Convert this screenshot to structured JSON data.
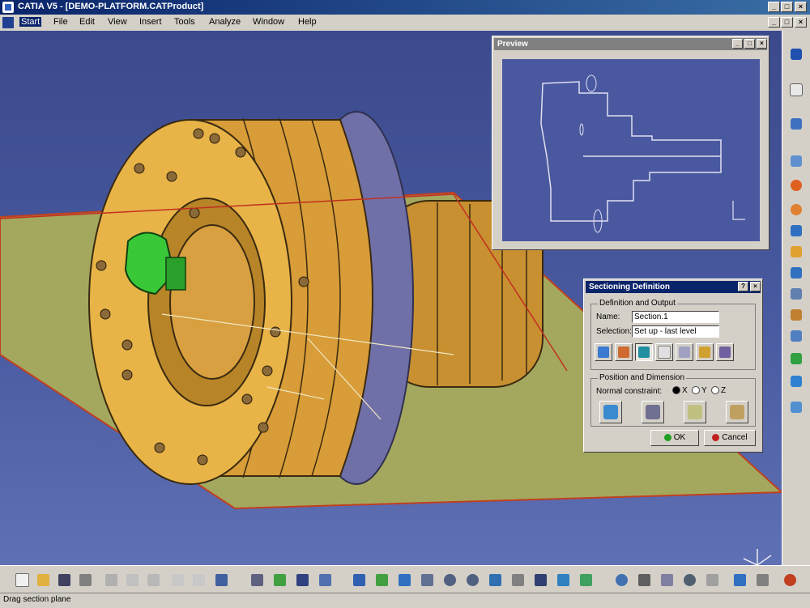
{
  "window": {
    "title": "CATIA V5 - [DEMO-PLATFORM.CATProduct]"
  },
  "menu": [
    "Start",
    "File",
    "Edit",
    "View",
    "Insert",
    "Tools",
    "Analyze",
    "Window",
    "Help"
  ],
  "preview": {
    "title": "Preview"
  },
  "sectioning": {
    "title": "Sectioning Definition",
    "group1": "Definition and Output",
    "name_label": "Name:",
    "name_value": "Section.1",
    "selection_label": "Selection:",
    "selection_value": "Set up - last level",
    "group2": "Position and Dimension",
    "normal_label": "Normal constraint:",
    "radio_x": "X",
    "radio_y": "Y",
    "radio_z": "Z",
    "ok": "OK",
    "cancel": "Cancel"
  },
  "statusbar": {
    "text": "Drag section plane"
  },
  "colors": {
    "title_active": "#0a246a",
    "viewport": "#4a5aa0",
    "part": "#e8b040",
    "plane": "#9aa060",
    "green_part": "#30c030"
  },
  "icons": {
    "right_toolbar": [
      "catia-logo-icon",
      "select-icon",
      "sketch-icon",
      "plane-icon",
      "shape-icon",
      "analysis-icon",
      "section-icon",
      "clash-icon",
      "measure-icon",
      "pointer-icon",
      "compass-icon",
      "snap-icon",
      "camera-icon",
      "grid-icon",
      "simulation-icon"
    ],
    "bottom_toolbar": [
      "new-icon",
      "open-icon",
      "save-icon",
      "print-icon",
      "cut-icon",
      "copy-icon",
      "paste-icon",
      "undo-icon",
      "redo-icon",
      "help-icon",
      "tree-icon",
      "manipulate-icon",
      "align-icon",
      "product-icon",
      "fit-all-icon",
      "pan-icon",
      "rotate-icon",
      "zoom-in-icon",
      "zoom-out-icon",
      "normal-view-icon",
      "iso-view-icon",
      "render-icon",
      "hide-icon",
      "swap-icon",
      "space-icon",
      "fly-icon",
      "walk-icon",
      "layer-icon",
      "lens-icon",
      "light-icon",
      "shading-icon",
      "grid-icon",
      "filter-icon"
    ]
  }
}
